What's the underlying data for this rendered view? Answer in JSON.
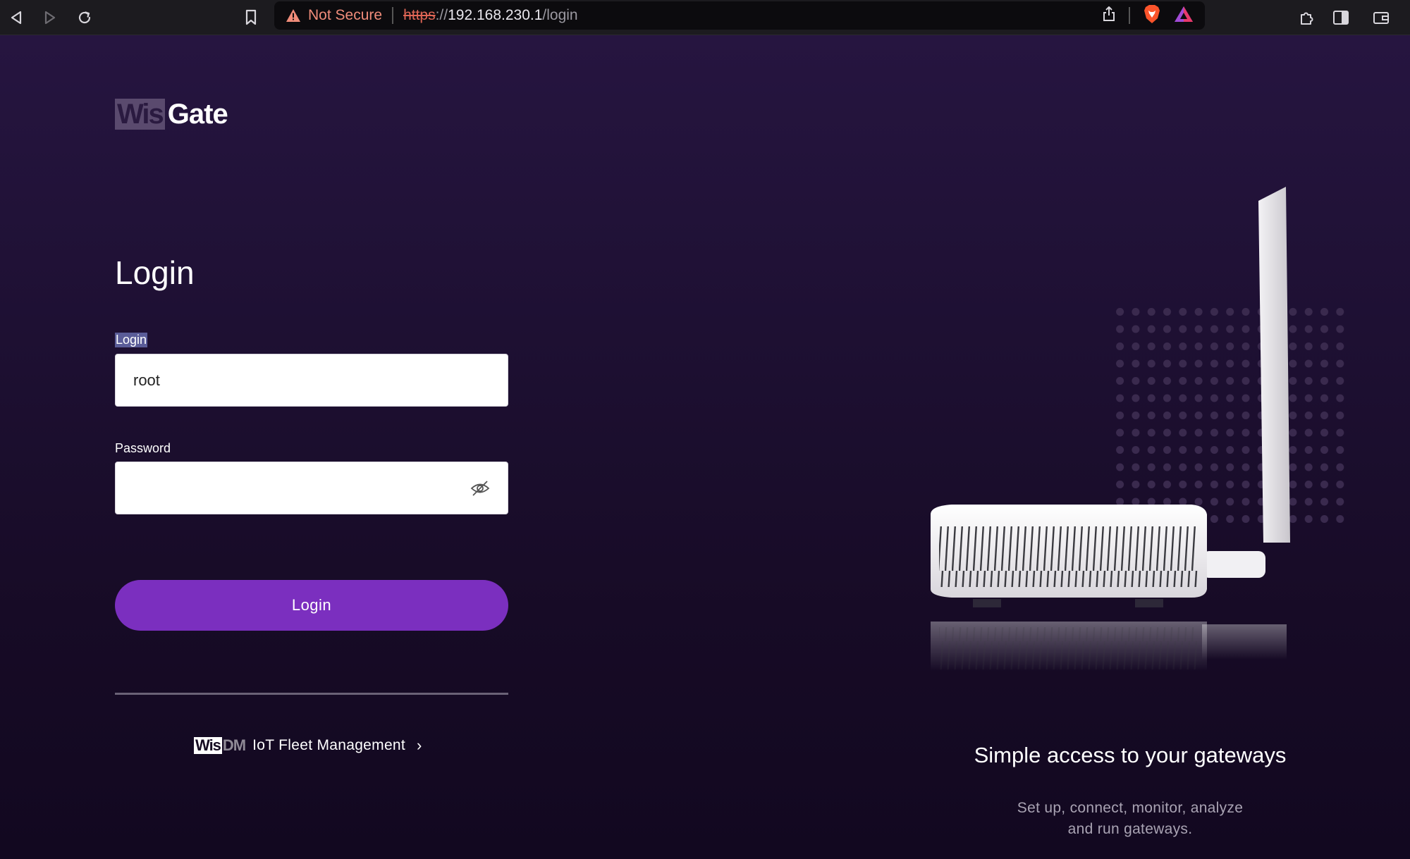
{
  "browser": {
    "security_label": "Not Secure",
    "url_scheme": "https",
    "url_separator": "://",
    "url_host": "192.168.230.1",
    "url_path": "/login"
  },
  "logo": {
    "part1": "Wis",
    "part2": "Gate"
  },
  "form": {
    "title": "Login",
    "login_label": "Login",
    "login_value": "root",
    "password_label": "Password",
    "password_value": "",
    "submit_label": "Login"
  },
  "footer_link": {
    "logo_part1": "Wis",
    "logo_part2": "DM",
    "label": "IoT Fleet Management",
    "chevron": "›"
  },
  "promo": {
    "title": "Simple access to your gateways",
    "subtitle_line1": "Set up, connect, monitor, analyze",
    "subtitle_line2": "and run gateways."
  },
  "colors": {
    "accent": "#7b2fbf",
    "background": "#1e1033",
    "warning": "#f08c7a"
  }
}
